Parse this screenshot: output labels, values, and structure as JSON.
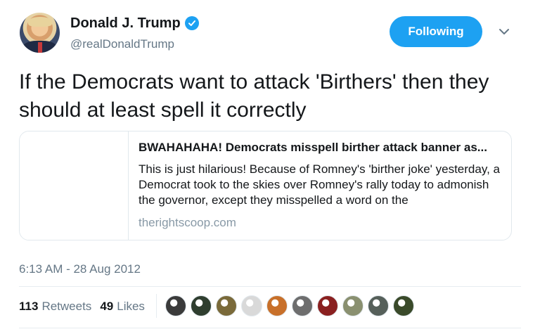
{
  "author": {
    "display_name": "Donald J. Trump",
    "handle": "@realDonaldTrump",
    "verified": true
  },
  "actions": {
    "follow_label": "Following"
  },
  "tweet": {
    "text": "If the Democrats want to attack 'Birthers' then they should at least spell it correctly",
    "timestamp": "6:13 AM - 28 Aug 2012"
  },
  "card": {
    "title": "BWAHAHAHA! Democrats misspell birther attack banner as...",
    "description": "This is just hilarious! Because of Romney's 'birther joke' yesterday, a Democrat took to the skies over Romney's rally today to admonish the governor, except they misspelled a word on the",
    "domain": "therightscoop.com"
  },
  "stats": {
    "retweets_count": "113",
    "retweets_label": "Retweets",
    "likes_count": "49",
    "likes_label": "Likes"
  },
  "likers": [
    {
      "color": "#3b3b3b"
    },
    {
      "color": "#2f3e2f"
    },
    {
      "color": "#7a6a3a"
    },
    {
      "color": "#d9d9d9"
    },
    {
      "color": "#c8702a"
    },
    {
      "color": "#6e6e6e"
    },
    {
      "color": "#8a2020"
    },
    {
      "color": "#8a9070"
    },
    {
      "color": "#56605a"
    },
    {
      "color": "#3a4a2a"
    }
  ],
  "colors": {
    "accent": "#1da1f2",
    "secondary_text": "#657786"
  }
}
